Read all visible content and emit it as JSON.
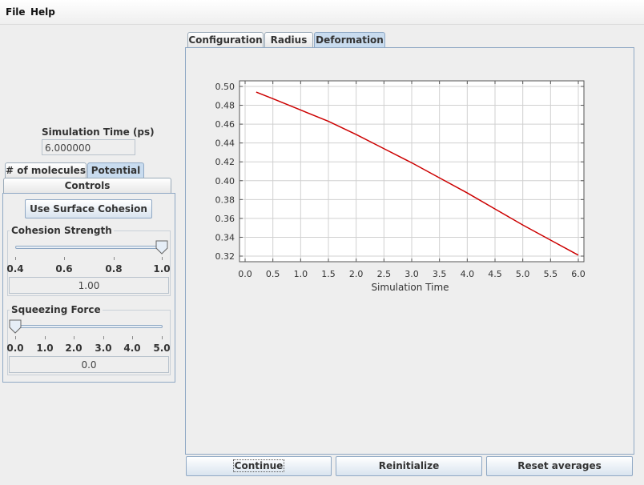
{
  "menu": {
    "file": "File",
    "help": "Help"
  },
  "simulation_time": {
    "label": "Simulation Time (ps)",
    "value": "6.000000"
  },
  "left_tabs": {
    "molecules": "# of molecules",
    "potential": "Potential",
    "controls": "Controls"
  },
  "surface_cohesion_button": "Use Surface Cohesion",
  "cohesion": {
    "title": "Cohesion Strength",
    "ticks": [
      "0.4",
      "0.6",
      "0.8",
      "1.0"
    ],
    "value": "1.00",
    "min": 0.4,
    "max": 1.0,
    "current": 1.0
  },
  "squeezing": {
    "title": "Squeezing Force",
    "ticks": [
      "0.0",
      "1.0",
      "2.0",
      "3.0",
      "4.0",
      "5.0"
    ],
    "value": "0.0",
    "min": 0.0,
    "max": 5.0,
    "current": 0.0
  },
  "main_tabs": {
    "configuration": "Configuration",
    "radius": "Radius",
    "deformation": "Deformation"
  },
  "bottom_buttons": {
    "continue": "Continue",
    "reinitialize": "Reinitialize",
    "reset": "Reset averages"
  },
  "colors": {
    "line": "#cc0000",
    "selected_tab": "#c9dcef",
    "border": "#8fa8c4"
  },
  "chart_data": {
    "type": "line",
    "xlabel": "Simulation Time",
    "ylabel": "",
    "xlim": [
      0.0,
      6.0
    ],
    "ylim": [
      0.32,
      0.5
    ],
    "xticks": [
      "0.0",
      "0.5",
      "1.0",
      "1.5",
      "2.0",
      "2.5",
      "3.0",
      "3.5",
      "4.0",
      "4.5",
      "5.0",
      "5.5",
      "6.0"
    ],
    "yticks": [
      "0.50",
      "0.48",
      "0.46",
      "0.44",
      "0.42",
      "0.40",
      "0.38",
      "0.36",
      "0.34",
      "0.32"
    ],
    "grid": true,
    "series": [
      {
        "x": [
          0.2,
          0.5,
          1.0,
          1.5,
          2.0,
          2.5,
          3.0,
          3.5,
          4.0,
          4.5,
          5.0,
          5.5,
          6.0
        ],
        "y": [
          0.494,
          0.487,
          0.475,
          0.463,
          0.449,
          0.434,
          0.419,
          0.403,
          0.387,
          0.37,
          0.353,
          0.337,
          0.321
        ]
      }
    ]
  }
}
